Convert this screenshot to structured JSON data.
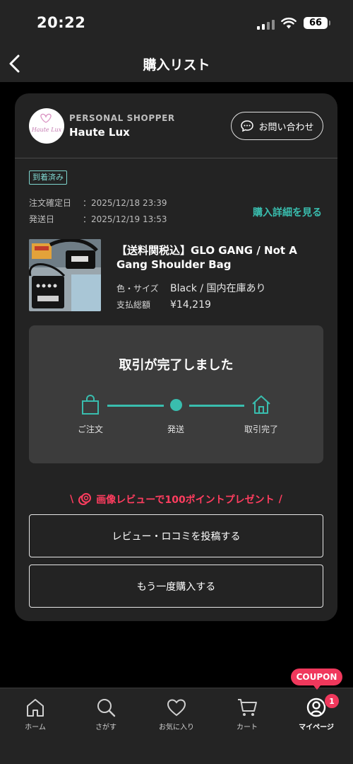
{
  "status_bar": {
    "time": "20:22",
    "battery": "66"
  },
  "header": {
    "title": "購入リスト"
  },
  "shop": {
    "logo_text": "Haute Lux",
    "subtitle": "PERSONAL SHOPPER",
    "name": "Haute Lux",
    "contact_label": "お問い合わせ"
  },
  "order": {
    "status_badge": "到着済み",
    "confirmed_label": "注文確定日",
    "confirmed_value": "：2025/12/18 23:39",
    "shipped_label": "発送日",
    "shipped_value": "：2025/12/19 13:53",
    "detail_link": "購入詳細を見る"
  },
  "product": {
    "name": "【送料関税込】GLO GANG / Not A Gang Shoulder Bag",
    "spec_label": "色・サイズ",
    "spec_value": "Black / 国内在庫あり",
    "total_label": "支払総額",
    "total_value": "¥14,219"
  },
  "progress": {
    "title": "取引が完了しました",
    "steps": [
      {
        "label": "ご注文",
        "icon": "shopping-bag-icon"
      },
      {
        "label": "発送",
        "icon": "dot-icon"
      },
      {
        "label": "取引完了",
        "icon": "house-icon"
      }
    ]
  },
  "promo": {
    "text": "画像レビューで100ポイントプレゼント"
  },
  "actions": {
    "review_label": "レビュー・ロコミを投稿する",
    "rebuy_label": "もう一度購入する"
  },
  "tab_bar": {
    "coupon_label": "COUPON",
    "notification_count": "1",
    "tabs": [
      {
        "label": "ホーム",
        "icon": "home-icon"
      },
      {
        "label": "さがす",
        "icon": "search-icon"
      },
      {
        "label": "お気に入り",
        "icon": "heart-icon"
      },
      {
        "label": "カート",
        "icon": "cart-icon"
      },
      {
        "label": "マイページ",
        "icon": "user-icon"
      }
    ]
  },
  "colors": {
    "accent": "#39bdae",
    "promo": "#ff3d5f",
    "badge": "#f0385c",
    "card": "#232323"
  }
}
